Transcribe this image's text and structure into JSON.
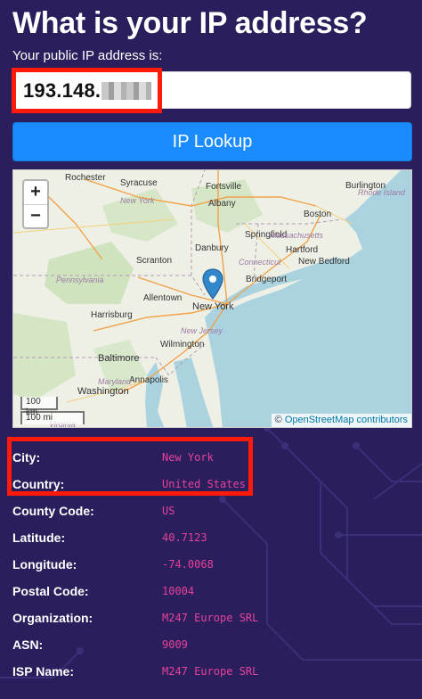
{
  "header": {
    "title": "What is your IP address?",
    "subtitle": "Your public IP address is:"
  },
  "ip_field": {
    "value_visible": "193.148.",
    "redacted": true
  },
  "lookup_button": {
    "label": "IP Lookup"
  },
  "map": {
    "zoom_in": "+",
    "zoom_out": "−",
    "scale_km": "100 km",
    "scale_mi": "100 mi",
    "attribution_symbol": "©",
    "attribution_link": "OpenStreetMap contributors",
    "marker_icon": "map-pin-icon",
    "cities": [
      "Rochester",
      "Syracuse",
      "Fortsville",
      "Albany",
      "Burlington",
      "Boston",
      "Springfield",
      "Hartford",
      "New Bedford",
      "Scranton",
      "Danbury",
      "Bridgeport",
      "New York",
      "Allentown",
      "Harrisburg",
      "Baltimore",
      "Wilmington",
      "Washington",
      "Annapolis"
    ],
    "regions": [
      "New York",
      "Massachusetts",
      "Connecticut",
      "Rhode Island",
      "Pennsylvania",
      "New Jersey",
      "Maryland",
      "Virginia"
    ]
  },
  "details": [
    {
      "label": "City:",
      "value": "New York"
    },
    {
      "label": "Country:",
      "value": "United States"
    },
    {
      "label": "County Code:",
      "value": "US"
    },
    {
      "label": "Latitude:",
      "value": "40.7123"
    },
    {
      "label": "Longitude:",
      "value": "-74.0068"
    },
    {
      "label": "Postal Code:",
      "value": "10004"
    },
    {
      "label": "Organization:",
      "value": "M247 Europe SRL"
    },
    {
      "label": "ASN:",
      "value": "9009"
    },
    {
      "label": "ISP Name:",
      "value": "M247 Europe SRL"
    }
  ],
  "colors": {
    "background": "#2a1f5c",
    "accent_button": "#1a8cff",
    "value_text": "#e6419a",
    "highlight_box": "#ff1a0a"
  }
}
